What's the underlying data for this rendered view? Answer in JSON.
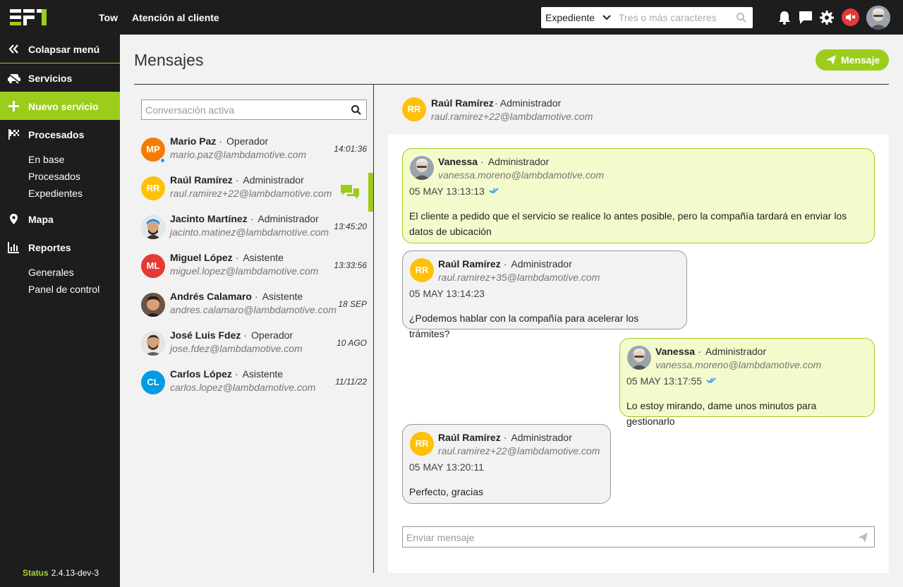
{
  "app": {
    "nav": [
      "Tow",
      "Atención al cliente"
    ]
  },
  "topsearch": {
    "selected": "Expediente",
    "placeholder": "Tres o más caracteres"
  },
  "sidebar": {
    "collapse": "Colapsar menú",
    "items": [
      {
        "label": "Servicios",
        "icon": "car-icon"
      },
      {
        "label": "Nuevo servicio",
        "icon": "plus-icon"
      },
      {
        "label": "Procesados",
        "icon": "flag-icon"
      },
      {
        "label": "Mapa",
        "icon": "map-pin-icon"
      },
      {
        "label": "Reportes",
        "icon": "bar-chart-icon"
      }
    ],
    "procesados_sub": [
      "En base",
      "Procesados",
      "Expedientes"
    ],
    "reportes_sub": [
      "Generales",
      "Panel de control"
    ],
    "status_label": "Status",
    "status_version": "2.4.13-dev-3"
  },
  "page": {
    "title": "Mensajes",
    "new_message": "Mensaje",
    "conv_search_placeholder": "Conversación activa"
  },
  "conversations": [
    {
      "initials": "MP",
      "color": "#f57c00",
      "name": "Mario Paz",
      "role": "Operador",
      "email": "mario.paz@lambdamotive.com",
      "time": "14:01:36",
      "online": true
    },
    {
      "initials": "RR",
      "color": "#ffc107",
      "name": "Raúl Ramírez",
      "role": "Administrador",
      "email": "raul.ramirez+22@lambdamotive.com",
      "time": "",
      "active": true
    },
    {
      "initials": "",
      "color": "#c9a27a",
      "name": "Jacinto Martínez",
      "role": "Administrador",
      "email": "jacinto.matinez@lambdamotive.com",
      "time": "13:45:20"
    },
    {
      "initials": "ML",
      "color": "#e53935",
      "name": "Miguel López",
      "role": "Asistente",
      "email": "miguel.lopez@lambdamotive.com",
      "time": "13:33:56"
    },
    {
      "initials": "",
      "color": "#8d6e63",
      "name": "Andrés Calamaro",
      "role": "Asistente",
      "email": "andres.calamaro@lambdamotive.com",
      "time": "18 SEP"
    },
    {
      "initials": "",
      "color": "#a1887f",
      "name": "José Luis Fdez",
      "role": "Operador",
      "email": "jose.fdez@lambdamotive.com",
      "time": "10 AGO"
    },
    {
      "initials": "CL",
      "color": "#039be5",
      "name": "Carlos López",
      "role": "Asistente",
      "email": "carlos.lopez@lambdamotive.com",
      "time": "11/11/22"
    }
  ],
  "chat": {
    "initials": "RR",
    "name": "Raúl Ramírez",
    "role": "Administrador",
    "email": "raul.ramirez+22@lambdamotive.com",
    "send_placeholder": "Enviar mensaje"
  },
  "messages": [
    {
      "name": "Vanessa",
      "role": "Administrador",
      "email": "vanessa.moreno@lambdamotive.com",
      "date": "05 MAY 13:13:13",
      "text": "El cliente a pedido que el servicio se realice lo antes posible, pero la compañía tardará en enviar los datos de ubicación",
      "mine": true
    },
    {
      "initials": "RR",
      "name": "Raúl Ramírez",
      "role": "Administrador",
      "email": "raul.ramirez+35@lambdamotive.com",
      "date": "05 MAY 13:14:23",
      "text": "¿Podemos hablar con la compañía para acelerar los trámites?"
    },
    {
      "name": "Vanessa",
      "role": "Administrador",
      "email": "vanessa.moreno@lambdamotive.com",
      "date": "05 MAY 13:17:55",
      "text": "Lo estoy mirando, dame unos minutos para gestionarlo",
      "mine": true
    },
    {
      "initials": "RR",
      "name": "Raúl Ramírez",
      "role": "Administrador",
      "email": "raul.ramirez+22@lambdamotive.com",
      "date": "05 MAY 13:20:11",
      "text": "Perfecto, gracias"
    }
  ],
  "colors": {
    "accent": "#9ccc1c",
    "dark": "#1d1d1d",
    "check": "#2196f3"
  }
}
